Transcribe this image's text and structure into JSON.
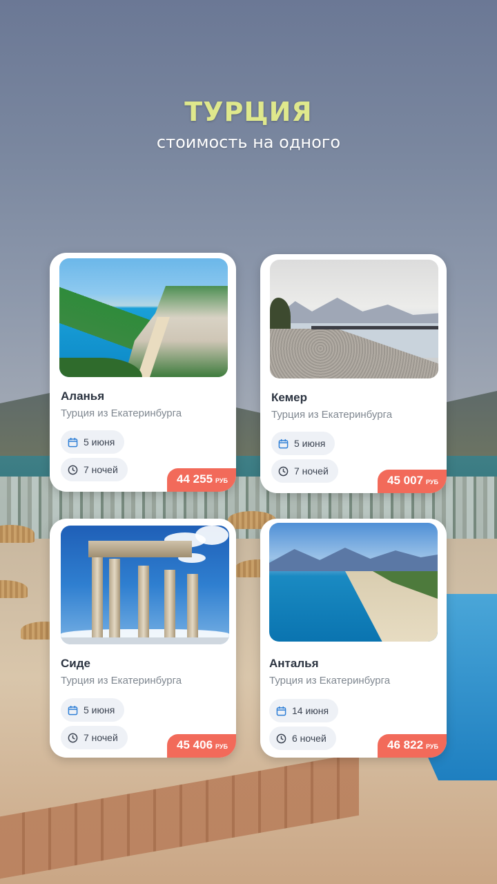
{
  "header": {
    "title": "ТУРЦИЯ",
    "subtitle": "стоимость на одного"
  },
  "colors": {
    "title": "#dfe88c",
    "price_badge": "#f26a5a",
    "card_bg": "#ffffff",
    "chip_bg": "#eef1f6"
  },
  "icons": {
    "date": "calendar-icon",
    "nights": "clock-icon"
  },
  "tours": [
    {
      "city": "Аланья",
      "route": "Турция из Екатеринбурга",
      "date": "5 июня",
      "nights": "7 ночей",
      "price": "44 255",
      "currency": "РУБ",
      "photo": "alanya-coast-photo"
    },
    {
      "city": "Кемер",
      "route": "Турция из Екатеринбурга",
      "date": "5 июня",
      "nights": "7 ночей",
      "price": "45 007",
      "currency": "РУБ",
      "photo": "kemer-pier-photo"
    },
    {
      "city": "Сиде",
      "route": "Турция из Екатеринбурга",
      "date": "5 июня",
      "nights": "7 ночей",
      "price": "45 406",
      "currency": "РУБ",
      "photo": "side-temple-photo"
    },
    {
      "city": "Анталья",
      "route": "Турция из Екатеринбурга",
      "date": "14 июня",
      "nights": "6 ночей",
      "price": "46 822",
      "currency": "РУБ",
      "photo": "antalya-beach-photo"
    }
  ]
}
